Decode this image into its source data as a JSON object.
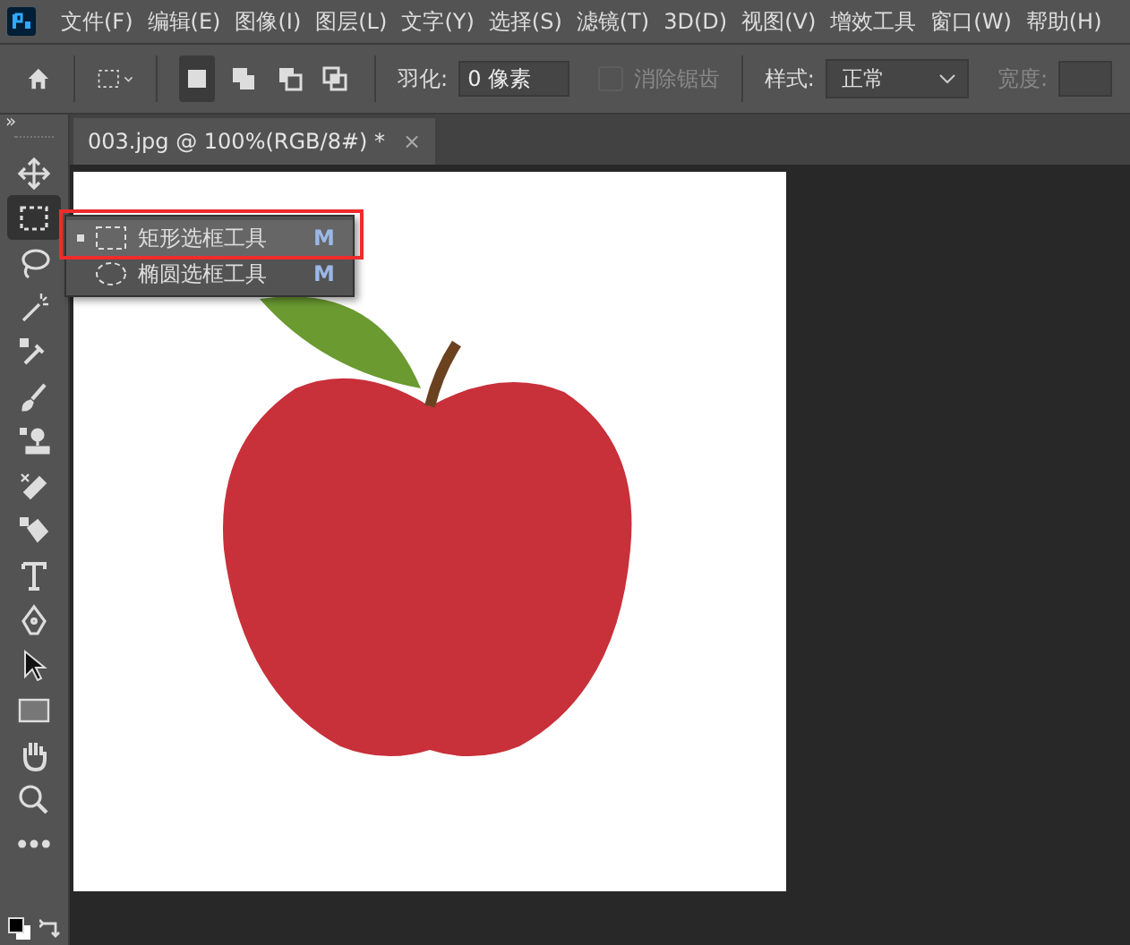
{
  "menu_bar": {
    "items": [
      "文件(F)",
      "编辑(E)",
      "图像(I)",
      "图层(L)",
      "文字(Y)",
      "选择(S)",
      "滤镜(T)",
      "3D(D)",
      "视图(V)",
      "增效工具",
      "窗口(W)",
      "帮助(H)"
    ]
  },
  "options_bar": {
    "selection_modes": [
      {
        "kind": "new",
        "selected": true
      },
      {
        "kind": "add",
        "selected": false
      },
      {
        "kind": "subtract",
        "selected": false
      },
      {
        "kind": "intersect",
        "selected": false
      }
    ],
    "feather_label": "羽化:",
    "feather_value": "0 像素",
    "anti_alias": {
      "label": "消除锯齿",
      "checked": false,
      "disabled": true
    },
    "style_label": "样式:",
    "style_value": "正常",
    "width_label": "宽度:"
  },
  "toolbar": {
    "collapse": "»",
    "tools": [
      {
        "kind": "move",
        "selected": false
      },
      {
        "kind": "marquee",
        "selected": true
      },
      {
        "kind": "lasso",
        "selected": false
      },
      {
        "kind": "wand",
        "selected": false
      },
      {
        "kind": "eyedropper",
        "selected": false
      },
      {
        "kind": "brush",
        "selected": false
      },
      {
        "kind": "stamp",
        "selected": false
      },
      {
        "kind": "eraser",
        "selected": false
      },
      {
        "kind": "bucket",
        "selected": false
      },
      {
        "kind": "type",
        "selected": false
      },
      {
        "kind": "pen",
        "selected": false
      },
      {
        "kind": "arrow",
        "selected": false
      },
      {
        "kind": "rectangle",
        "selected": false
      },
      {
        "kind": "hand",
        "selected": false
      },
      {
        "kind": "zoom",
        "selected": false
      },
      {
        "kind": "more",
        "selected": false
      }
    ]
  },
  "document_tab": {
    "title": "003.jpg @ 100%(RGB/8#) *",
    "close": "×",
    "selected": true
  },
  "tool_flyout": {
    "items": [
      {
        "kind": "rect",
        "label": "矩形选框工具",
        "shortcut": "M",
        "selected": true
      },
      {
        "kind": "ellipse",
        "label": "椭圆选框工具",
        "shortcut": "M",
        "selected": false
      }
    ]
  }
}
